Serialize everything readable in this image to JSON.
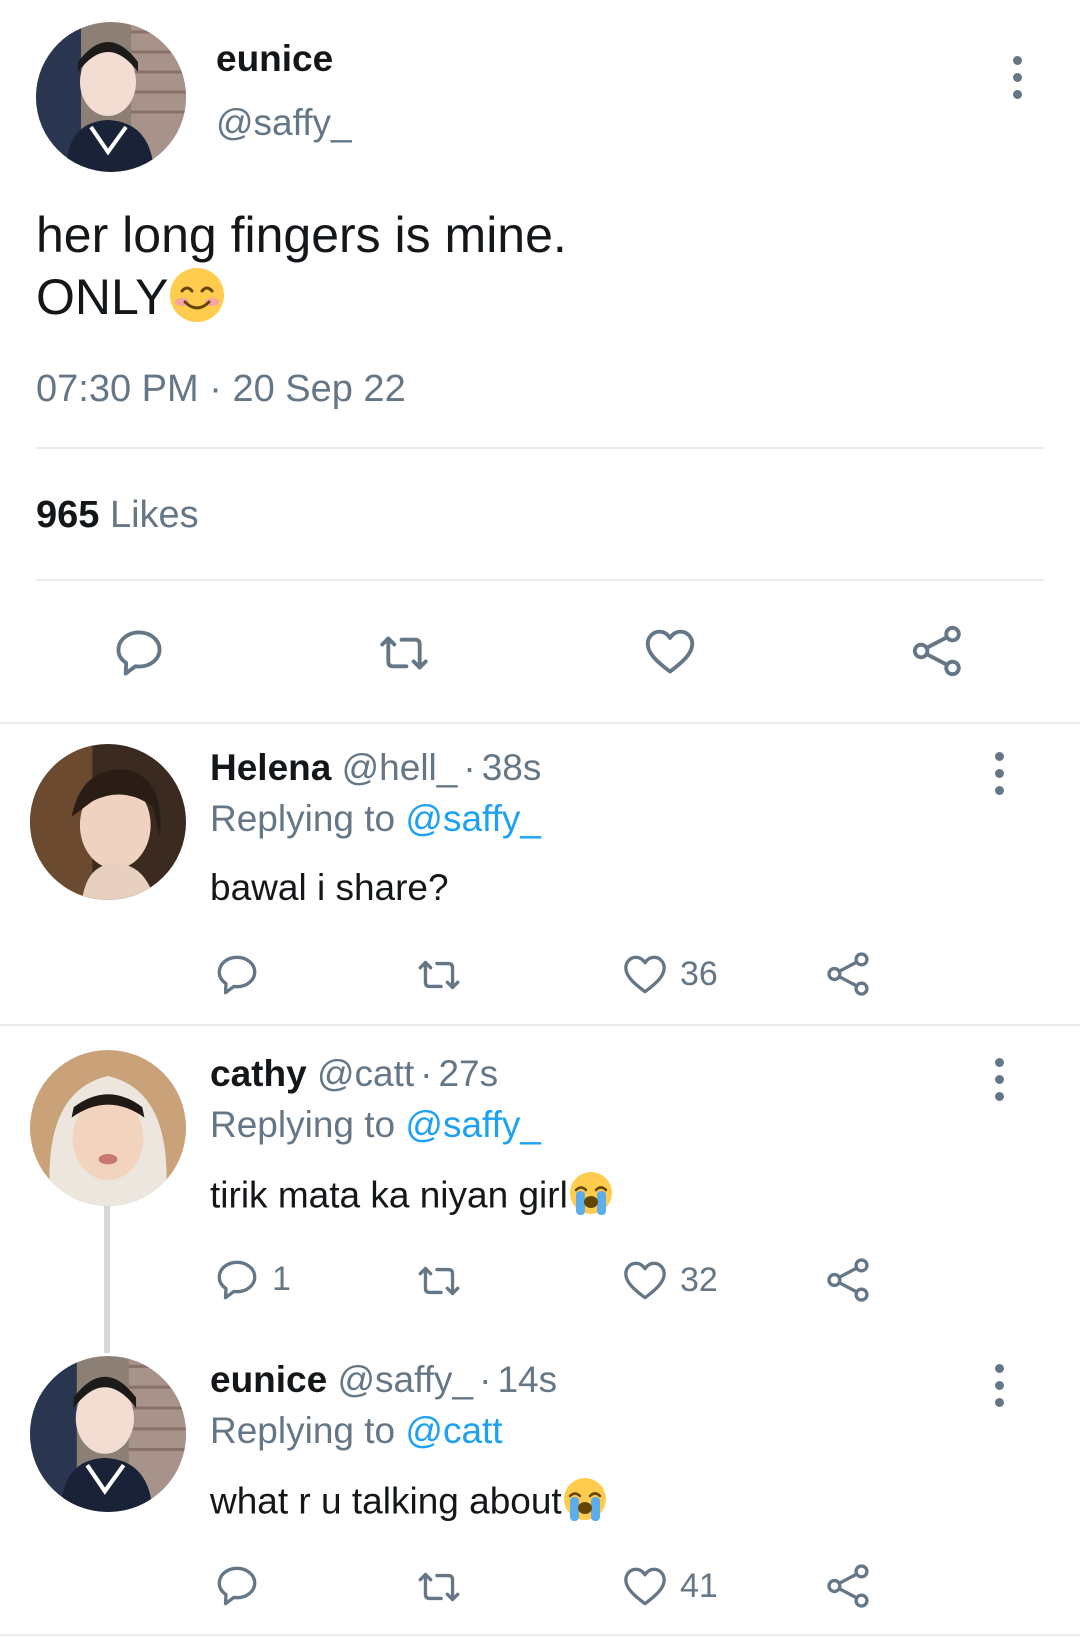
{
  "main_tweet": {
    "display_name": "eunice",
    "handle": "@saffy_",
    "text_line1": "her long fingers is mine.",
    "text_line2": "ONLY",
    "text_line2_emoji": "smiling-face-with-smiling-eyes",
    "time": "07:30 PM",
    "separator": "·",
    "date": "20 Sep 22",
    "likes_count": "965",
    "likes_label": "Likes"
  },
  "replies": [
    {
      "display_name": "Helena",
      "handle": "@hell_",
      "time_sep": "·",
      "age": "38s",
      "replying_prefix": "Replying to",
      "replying_to": "@saffy_",
      "text": "bawal i share?",
      "text_emoji": "",
      "reply_count": "",
      "like_count": "36"
    },
    {
      "display_name": "cathy",
      "handle": "@catt",
      "time_sep": "·",
      "age": "27s",
      "replying_prefix": "Replying to",
      "replying_to": "@saffy_",
      "text": "tirik mata ka niyan girl",
      "text_emoji": "loudly-crying-face",
      "reply_count": "1",
      "like_count": "32"
    },
    {
      "display_name": "eunice",
      "handle": "@saffy_",
      "time_sep": "·",
      "age": "14s",
      "replying_prefix": "Replying to",
      "replying_to": "@catt",
      "text": "what r u talking about",
      "text_emoji": "loudly-crying-face",
      "reply_count": "",
      "like_count": "41"
    }
  ],
  "colors": {
    "text": "#14171a",
    "secondary": "#657786",
    "link": "#1da1f2",
    "divider": "#e6ecf0"
  }
}
